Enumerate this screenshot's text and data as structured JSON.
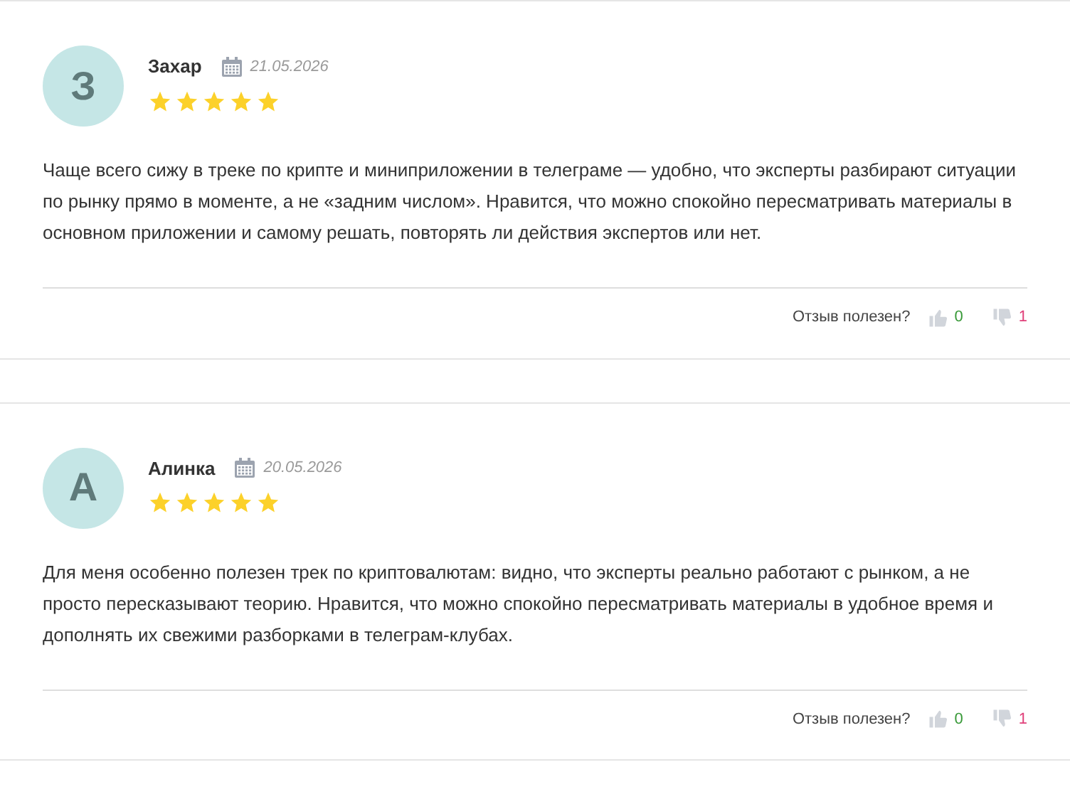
{
  "reviews": [
    {
      "avatar_letter": "З",
      "author": "Захар",
      "date": "21.05.2026",
      "stars": 5,
      "text": "Чаще всего сижу в треке по крипте и миниприложении в телеграме — удобно, что эксперты разбирают ситуации по рынку прямо в моменте, а не «задним числом». Нравится, что можно спокойно пересматривать материалы в основном приложении и самому решать, повторять ли действия экспертов или нет.",
      "helpful_label": "Отзыв полезен?",
      "likes": "0",
      "dislikes": "1"
    },
    {
      "avatar_letter": "А",
      "author": "Алинка",
      "date": "20.05.2026",
      "stars": 5,
      "text": "Для меня особенно полезен трек по криптовалютам: видно, что эксперты реально работают с рынком, а не просто пересказывают теорию. Нравится, что можно спокойно пересматривать материалы в удобное время и дополнять их свежими разборками в телеграм-клубах.",
      "helpful_label": "Отзыв полезен?",
      "likes": "0",
      "dislikes": "1"
    }
  ]
}
